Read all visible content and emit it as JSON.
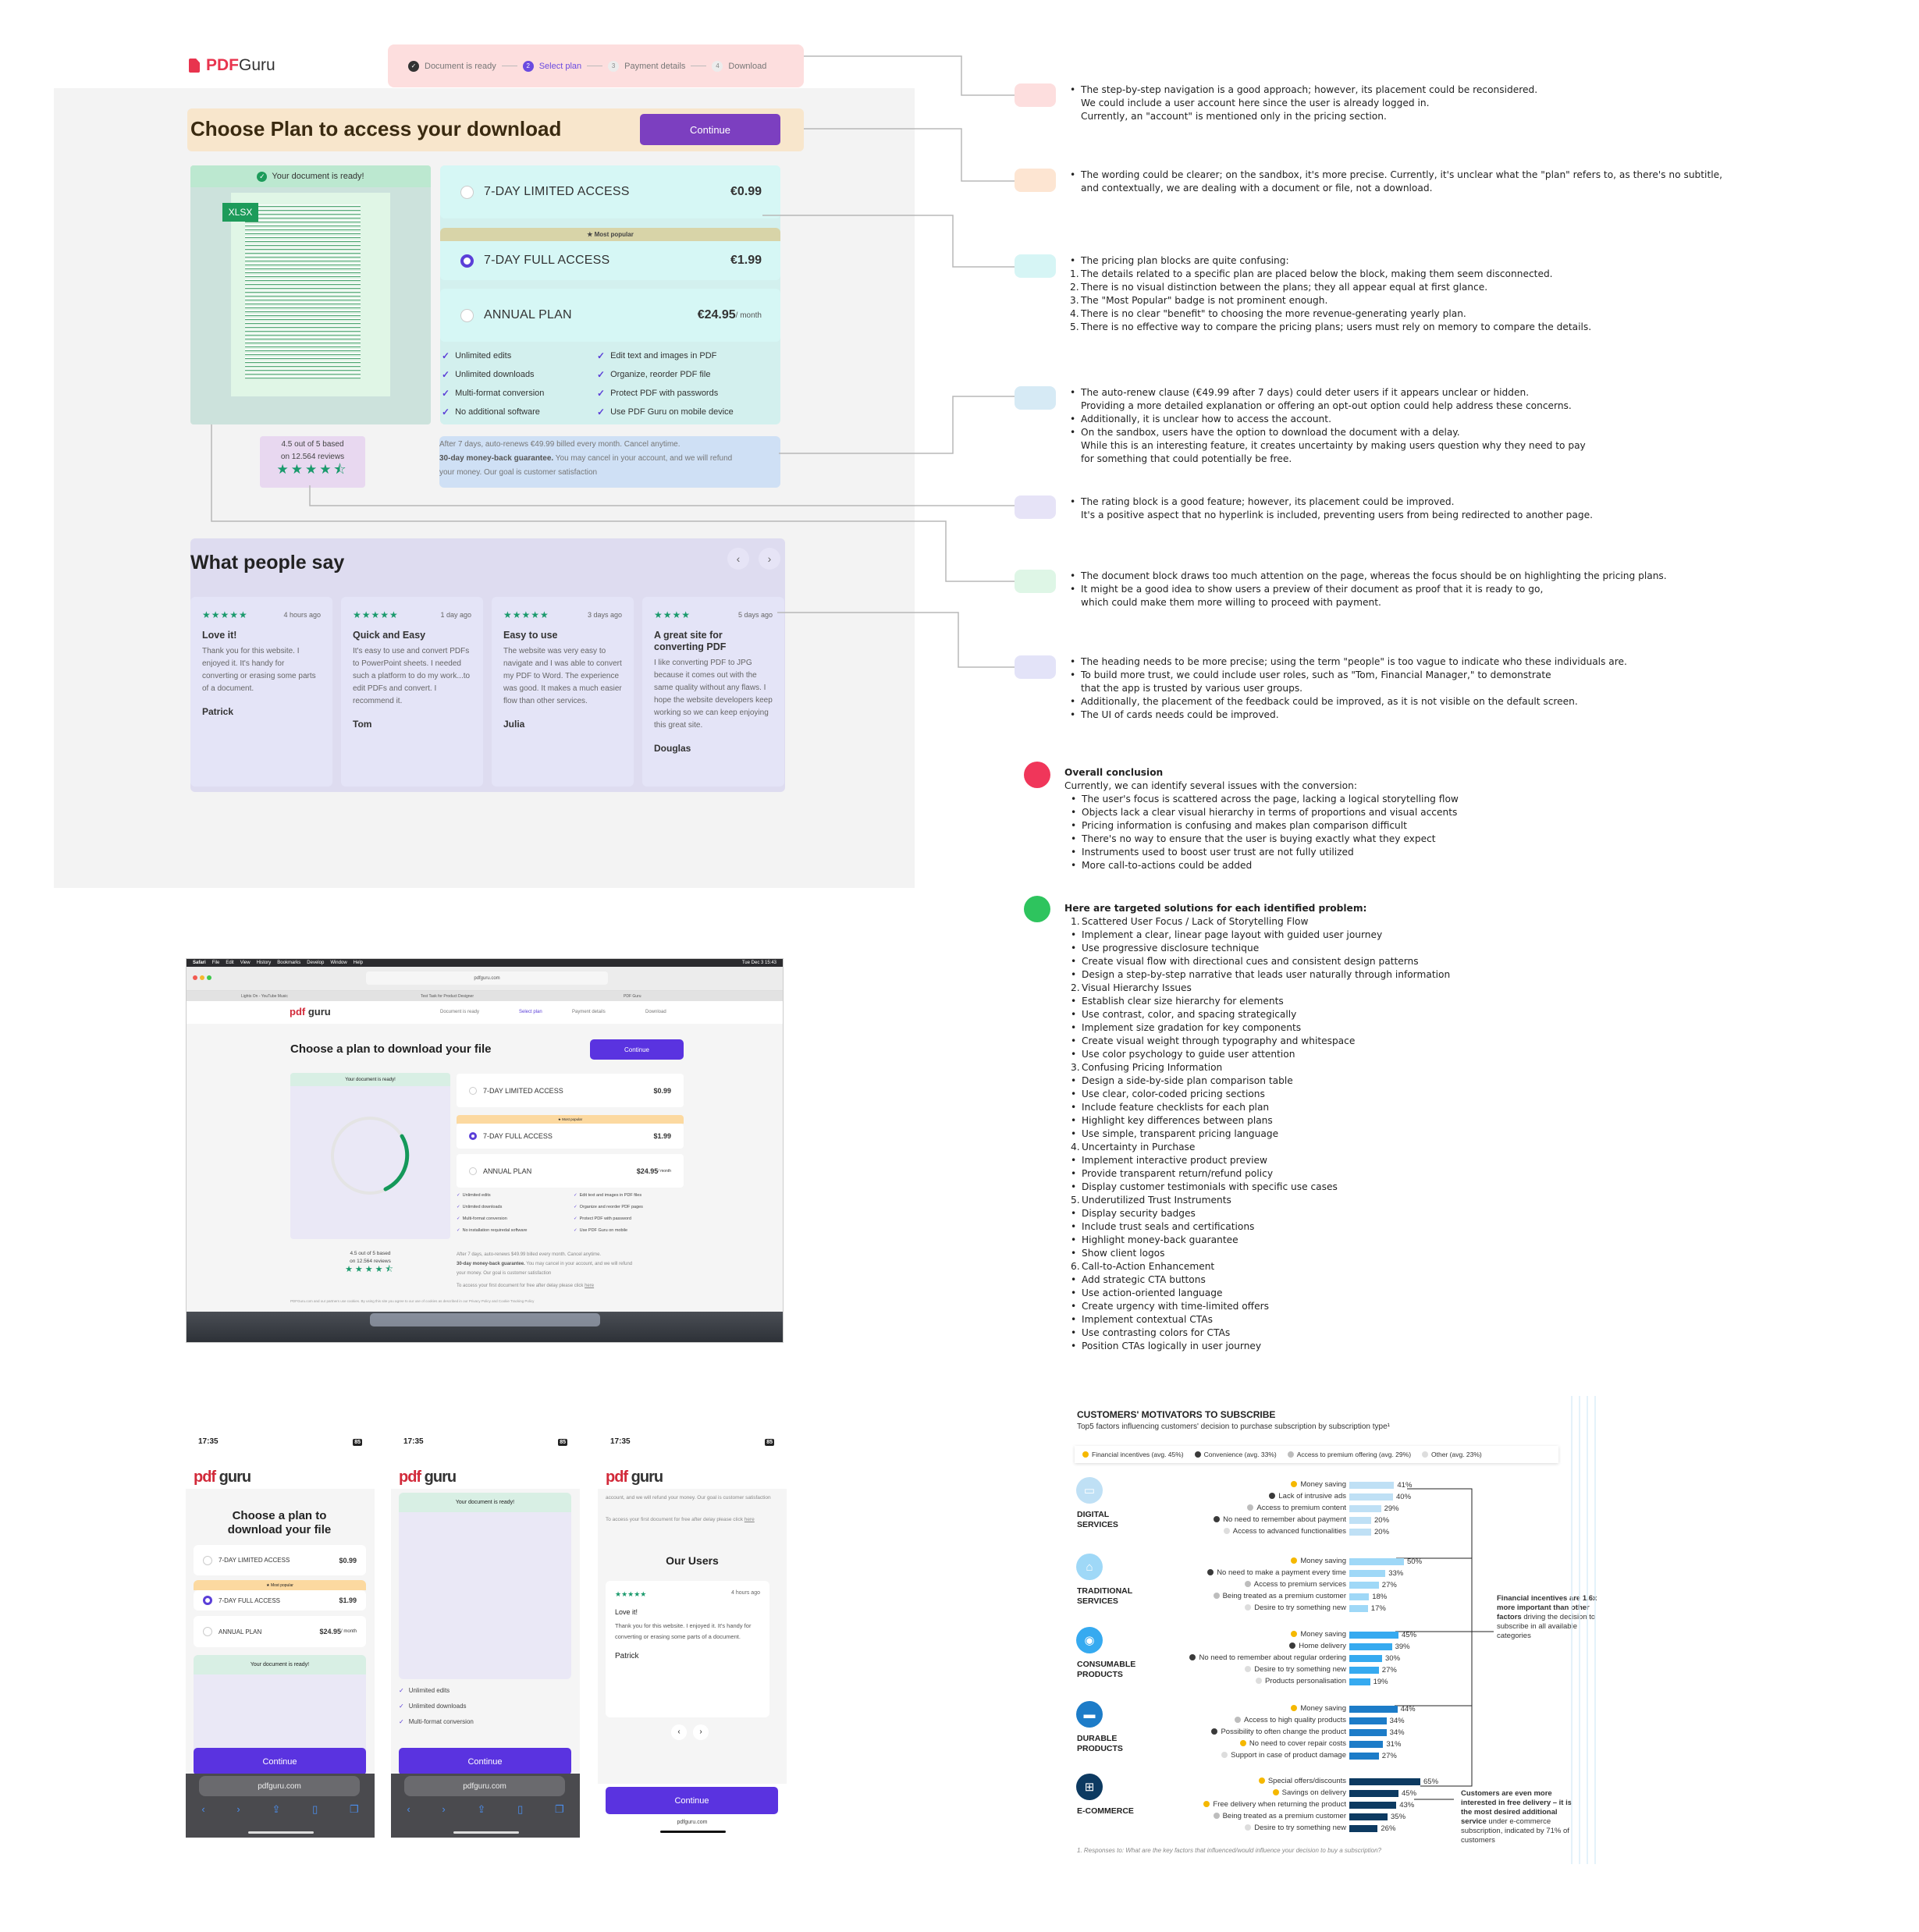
{
  "mockup": {
    "logo": {
      "brand": "PDF",
      "name": " Guru"
    },
    "stepper": [
      {
        "num": "✓",
        "label": "Document is ready",
        "state": "done"
      },
      {
        "num": "2",
        "label": "Select plan",
        "state": "active"
      },
      {
        "num": "3",
        "label": "Payment details",
        "state": "todo"
      },
      {
        "num": "4",
        "label": "Download",
        "state": "todo"
      }
    ],
    "heading": "Choose Plan to access your download",
    "continue_label": "Continue",
    "doc_ready": "Your document is ready!",
    "file_badge": "XLSX",
    "plans": [
      {
        "name": "7-DAY LIMITED ACCESS",
        "price": "€0.99",
        "unit": "",
        "selected": false
      },
      {
        "name": "7-DAY FULL ACCESS",
        "price": "€1.99",
        "unit": "",
        "selected": true
      },
      {
        "name": "ANNUAL PLAN",
        "price": "€24.95",
        "unit": "/ month",
        "selected": false
      }
    ],
    "most_popular": "★ Most popular",
    "features": [
      "Unlimited edits",
      "Edit text and images in PDF",
      "Unlimited downloads",
      "Organize, reorder PDF file",
      "Multi-format conversion",
      "Protect PDF with passwords",
      "No additional software",
      "Use PDF Guru on mobile device"
    ],
    "rating": {
      "line1": "4.5 out of 5 based",
      "line2": "on 12.564 reviews",
      "value": 4.5
    },
    "autorenew": {
      "line1": "After 7 days, auto-renews €49.99 billed every month. Cancel anytime.",
      "bold": "30-day money-back guarantee.",
      "line2": " You may cancel in your account, and we will refund",
      "line3": "your money. Our goal is customer satisfaction"
    },
    "reviews_title": "What people say",
    "reviews": [
      {
        "rating": 5,
        "time": "4 hours ago",
        "title": "Love it!",
        "body": "Thank you for this website. I enjoyed it. It's handy for converting or erasing some parts of a document.",
        "author": "Patrick"
      },
      {
        "rating": 5,
        "time": "1 day ago",
        "title": "Quick and Easy",
        "body": "It's easy to use and convert PDFs to PowerPoint sheets. I needed such a platform to do my work...to edit PDFs and convert. I recommend it.",
        "author": "Tom"
      },
      {
        "rating": 5,
        "time": "3 days ago",
        "title": "Easy to use",
        "body": "The website was very easy to navigate and I was able to convert my PDF to Word. The experience was good. It makes a much easier flow than other services.",
        "author": "Julia"
      },
      {
        "rating": 4,
        "time": "5 days ago",
        "title": "A great site for converting PDF",
        "body": "I like converting PDF to JPG because it comes out with the same quality without any flaws. I hope the website developers keep working so we can keep enjoying this great site.",
        "author": "Douglas"
      }
    ]
  },
  "notes": [
    {
      "color": "#fddede",
      "lines": [
        {
          "m": "•",
          "t": "The step-by-step navigation is a good approach; however, its placement could be reconsidered."
        },
        {
          "m": "",
          "t": "We could include a user account here since the user is already logged in."
        },
        {
          "m": "",
          "t": "Currently, an \"account\" is mentioned only in the pricing section."
        }
      ]
    },
    {
      "color": "#fde5d2",
      "lines": [
        {
          "m": "•",
          "t": "The wording could be clearer; on the sandbox, it's more precise. Currently, it's unclear what the \"plan\" refers to, as there's no subtitle,"
        },
        {
          "m": "",
          "t": "and contextually, we are dealing with a document or file, not a download."
        }
      ]
    },
    {
      "color": "#d6f5f5",
      "lines": [
        {
          "m": "•",
          "t": "The pricing plan blocks are quite confusing:"
        },
        {
          "m": "1.",
          "t": "The details related to a specific plan are placed below the block, making them seem disconnected."
        },
        {
          "m": "2.",
          "t": "There is no visual distinction between the plans; they all appear equal at first glance."
        },
        {
          "m": "3.",
          "t": "The \"Most Popular\" badge is not prominent enough."
        },
        {
          "m": "4.",
          "t": "There is no clear \"benefit\" to choosing the more revenue-generating yearly plan."
        },
        {
          "m": "5.",
          "t": "There is no effective way to compare the pricing plans; users must rely on memory to compare the details."
        }
      ]
    },
    {
      "color": "#d6eaf5",
      "lines": [
        {
          "m": "•",
          "t": "The auto-renew clause (€49.99 after 7 days) could deter users if it appears unclear or hidden."
        },
        {
          "m": "",
          "t": "Providing a more detailed explanation or offering an opt-out option could help address these concerns."
        },
        {
          "m": "•",
          "t": "Additionally, it is unclear how to access the account."
        },
        {
          "m": "•",
          "t": "On the sandbox, users have the option to download the document with a delay."
        },
        {
          "m": "",
          "t": "While this is an interesting feature, it creates uncertainty by making users question why they need to pay"
        },
        {
          "m": "",
          "t": "for something that could potentially be free."
        }
      ]
    },
    {
      "color": "#e6e3f7",
      "lines": [
        {
          "m": "•",
          "t": "The rating block is a good feature; however, its placement could be improved."
        },
        {
          "m": "",
          "t": "It's a positive aspect that no hyperlink is included, preventing users from being redirected to another page."
        }
      ]
    },
    {
      "color": "#def6e6",
      "lines": [
        {
          "m": "•",
          "t": "The document block draws too much attention on the page, whereas the focus should be on highlighting the pricing plans."
        },
        {
          "m": "•",
          "t": "It might be a good idea to show users a preview of their document as proof that it is ready to go,"
        },
        {
          "m": "",
          "t": "which could make them more willing to proceed with payment."
        }
      ]
    },
    {
      "color": "#e3e3f8",
      "lines": [
        {
          "m": "•",
          "t": "The heading needs to be more precise; using the term \"people\" is too vague to indicate who these individuals are."
        },
        {
          "m": "•",
          "t": "To build more trust, we could include user roles, such as \"Tom, Financial Manager,\" to demonstrate"
        },
        {
          "m": "",
          "t": " that the app is trusted by various user groups."
        },
        {
          "m": "•",
          "t": "Additionally, the placement of the feedback could be improved, as it is not visible on the default screen."
        },
        {
          "m": "•",
          "t": "The UI of cards needs could be improved."
        }
      ]
    }
  ],
  "conclusion": {
    "color": "#f0365a",
    "title": "Overall conclusion",
    "intro": "Currently, we can identify several issues with the conversion:",
    "lines": [
      {
        "m": "•",
        "t": "The user's focus is scattered across the page, lacking a logical storytelling flow"
      },
      {
        "m": "•",
        "t": "Objects lack a clear visual hierarchy in terms of proportions and visual accents"
      },
      {
        "m": "•",
        "t": "Pricing information is confusing and makes plan comparison difficult"
      },
      {
        "m": "•",
        "t": "There's no way to ensure that the user is buying exactly what they expect"
      },
      {
        "m": "•",
        "t": "Instruments used to boost user trust are not fully utilized"
      },
      {
        "m": "•",
        "t": "More call-to-actions could be added"
      }
    ]
  },
  "solutions": {
    "color": "#2ec45e",
    "title": "Here are targeted solutions for each identified problem:",
    "lines": [
      {
        "m": "1.",
        "t": "Scattered User Focus / Lack of Storytelling Flow"
      },
      {
        "m": "•",
        "t": "Implement a clear, linear page layout with guided user journey"
      },
      {
        "m": "•",
        "t": "Use progressive disclosure technique"
      },
      {
        "m": "•",
        "t": "Create visual flow with directional cues and consistent design patterns"
      },
      {
        "m": "•",
        "t": "Design a step-by-step narrative that leads user naturally through information"
      },
      {
        "m": "2.",
        "t": "Visual Hierarchy Issues"
      },
      {
        "m": "•",
        "t": "Establish clear size hierarchy for elements"
      },
      {
        "m": "•",
        "t": "Use contrast, color, and spacing strategically"
      },
      {
        "m": "•",
        "t": "Implement size gradation for key components"
      },
      {
        "m": "•",
        "t": "Create visual weight through typography and whitespace"
      },
      {
        "m": "•",
        "t": "Use color psychology to guide user attention"
      },
      {
        "m": "3.",
        "t": "Confusing Pricing Information"
      },
      {
        "m": "•",
        "t": "Design a side-by-side plan comparison table"
      },
      {
        "m": "•",
        "t": "Use clear, color-coded pricing sections"
      },
      {
        "m": "•",
        "t": "Include feature checklists for each plan"
      },
      {
        "m": "•",
        "t": "Highlight key differences between plans"
      },
      {
        "m": "•",
        "t": "Use simple, transparent pricing language"
      },
      {
        "m": "4.",
        "t": "Uncertainty in Purchase"
      },
      {
        "m": "•",
        "t": "Implement interactive product preview"
      },
      {
        "m": "•",
        "t": "Provide transparent return/refund policy"
      },
      {
        "m": "•",
        "t": "Display customer testimonials with specific use cases"
      },
      {
        "m": "5.",
        "t": "Underutilized Trust Instruments"
      },
      {
        "m": "•",
        "t": "Display security badges"
      },
      {
        "m": "•",
        "t": "Include trust seals and certifications"
      },
      {
        "m": "•",
        "t": "Highlight money-back guarantee"
      },
      {
        "m": "•",
        "t": "Show client logos"
      },
      {
        "m": "6.",
        "t": "Call-to-Action Enhancement"
      },
      {
        "m": "•",
        "t": "Add strategic CTA buttons"
      },
      {
        "m": "•",
        "t": "Use action-oriented language"
      },
      {
        "m": "•",
        "t": "Create urgency with time-limited offers"
      },
      {
        "m": "•",
        "t": "Implement contextual CTAs"
      },
      {
        "m": "•",
        "t": "Use contrasting colors for CTAs"
      },
      {
        "m": "•",
        "t": "Position CTAs logically in user journey"
      }
    ]
  },
  "desktop": {
    "menubar": [
      "Safari",
      "File",
      "Edit",
      "View",
      "History",
      "Bookmarks",
      "Develop",
      "Window",
      "Help"
    ],
    "clock": "Tue Dec 3  15:43",
    "url": "pdfguru.com",
    "tabs": [
      "Lights On - YouTube Music",
      "Test Task for Product Designer",
      "PDF Guru"
    ],
    "logo": {
      "brand": "pdf",
      "name": " guru"
    },
    "stepper": [
      "Document is ready",
      "Select plan",
      "Payment details",
      "Download"
    ],
    "heading": "Choose a plan to download your file",
    "continue_label": "Continue",
    "doc_ready": "Your document is ready!",
    "plans": [
      {
        "name": "7-DAY LIMITED ACCESS",
        "price": "$0.99",
        "unit": ""
      },
      {
        "name": "7-DAY FULL ACCESS",
        "price": "$1.99",
        "unit": ""
      },
      {
        "name": "ANNUAL PLAN",
        "price": "$24.95",
        "unit": "/ month"
      }
    ],
    "most_popular": "★ Most popular",
    "features": [
      "Unlimited edits",
      "Edit text and images in PDF files",
      "Unlimited downloads",
      "Organize and reorder PDF pages",
      "Multi-format conversion",
      "Protect PDF with password",
      "No installation requiredal software",
      "Use PDF Guru on mobile"
    ],
    "rating": {
      "line1": "4.5 out of 5 based",
      "line2": "on 12.564 reviews"
    },
    "autorenew": {
      "line1": "After 7 days, auto-renews $49.99 billed every month. Cancel anytime.",
      "bold": "30-day money-back guarantee.",
      "line2": " You may cancel in your account, and we will refund",
      "line3": "your money. Our goal is customer satisfaction",
      "free_text": "To access your first document for free after delay please click ",
      "free_link": "here"
    },
    "cookie": "PDFGuru.com and our partners use cookies. By using this site you agree to our use of cookies as described in our Privacy Policy and Cookie Tracking Policy"
  },
  "mobile": {
    "time": "17:35",
    "battery": "85",
    "logo": {
      "brand": "pdf",
      "name": " guru"
    },
    "heading": "Choose a plan to download your file",
    "plans": [
      {
        "name": "7-DAY LIMITED ACCESS",
        "price": "$0.99",
        "unit": ""
      },
      {
        "name": "7-DAY FULL ACCESS",
        "price": "$1.99",
        "unit": ""
      },
      {
        "name": "ANNUAL PLAN",
        "price": "$24.95",
        "unit": "/ month"
      }
    ],
    "most_popular": "★ Most popular",
    "doc_ready": "Your document is ready!",
    "continue_label": "Continue",
    "url": "pdfguru.com",
    "features": [
      "Unlimited edits",
      "Unlimited downloads",
      "Multi-format conversion"
    ],
    "refund_text": "account, and we will refund your money. Our goal is customer satisfaction",
    "free_text": "To access your first document for free after delay please click ",
    "free_link": "here",
    "users_title": "Our Users",
    "review": {
      "rating": 5,
      "time": "4 hours ago",
      "title": "Love it!",
      "body": "Thank you for this website. I enjoyed it. It's handy for converting or erasing some parts of a document.",
      "author": "Patrick"
    }
  },
  "chart_data": {
    "type": "bar",
    "title": "CUSTOMERS' MOTIVATORS TO SUBSCRIBE",
    "subtitle": "Top5 factors influencing customers' decision to purchase subscription by subscription type¹",
    "legend": [
      {
        "key": "financial",
        "label": "Financial incentives (avg. 45%)",
        "color": "#f5b800"
      },
      {
        "key": "convenience",
        "label": "Convenience (avg. 33%)",
        "color": "#3a3a3a"
      },
      {
        "key": "premium",
        "label": "Access to premium offering (avg. 29%)",
        "color": "#bdbdbd"
      },
      {
        "key": "other",
        "label": "Other (avg. 23%)",
        "color": "#dddddd"
      }
    ],
    "unit": "%",
    "groups": [
      {
        "name": "DIGITAL SERVICES",
        "icon": "laptop-icon",
        "color": "#bfe0f5",
        "items": [
          {
            "label": "Money saving",
            "value": 41,
            "factor": "financial"
          },
          {
            "label": "Lack of intrusive ads",
            "value": 40,
            "factor": "convenience"
          },
          {
            "label": "Access to premium content",
            "value": 29,
            "factor": "premium"
          },
          {
            "label": "No need to remember about payment",
            "value": 20,
            "factor": "convenience"
          },
          {
            "label": "Access to advanced functionalities",
            "value": 20,
            "factor": "other"
          }
        ]
      },
      {
        "name": "TRADITIONAL SERVICES",
        "icon": "house-icon",
        "color": "#9fd8f7",
        "items": [
          {
            "label": "Money saving",
            "value": 50,
            "factor": "financial"
          },
          {
            "label": "No need to make a payment every time",
            "value": 33,
            "factor": "convenience"
          },
          {
            "label": "Access to premium services",
            "value": 27,
            "factor": "premium"
          },
          {
            "label": "Being treated as a premium customer",
            "value": 18,
            "factor": "premium"
          },
          {
            "label": "Desire to try something new",
            "value": 17,
            "factor": "other"
          }
        ]
      },
      {
        "name": "CONSUMABLE PRODUCTS",
        "icon": "bowl-icon",
        "color": "#36aaf0",
        "items": [
          {
            "label": "Money saving",
            "value": 45,
            "factor": "financial"
          },
          {
            "label": "Home delivery",
            "value": 39,
            "factor": "convenience"
          },
          {
            "label": "No need to remember about regular ordering",
            "value": 30,
            "factor": "convenience"
          },
          {
            "label": "Desire to try something new",
            "value": 27,
            "factor": "other"
          },
          {
            "label": "Products personalisation",
            "value": 19,
            "factor": "other"
          }
        ]
      },
      {
        "name": "DURABLE PRODUCTS",
        "icon": "sofa-icon",
        "color": "#1d7cc8",
        "items": [
          {
            "label": "Money saving",
            "value": 44,
            "factor": "financial"
          },
          {
            "label": "Access to high quality products",
            "value": 34,
            "factor": "premium"
          },
          {
            "label": "Possibility to often change the product",
            "value": 34,
            "factor": "convenience"
          },
          {
            "label": "No need to cover repair costs",
            "value": 31,
            "factor": "financial"
          },
          {
            "label": "Support in case of product damage",
            "value": 27,
            "factor": "other"
          }
        ]
      },
      {
        "name": "E-COMMERCE",
        "icon": "basket-icon",
        "color": "#0d3a61",
        "items": [
          {
            "label": "Special offers/discounts",
            "value": 65,
            "factor": "financial"
          },
          {
            "label": "Savings on delivery",
            "value": 45,
            "factor": "financial"
          },
          {
            "label": "Free delivery when returning the product",
            "value": 43,
            "factor": "financial"
          },
          {
            "label": "Being treated as a premium customer",
            "value": 35,
            "factor": "premium"
          },
          {
            "label": "Desire to try something new",
            "value": 26,
            "factor": "other"
          }
        ]
      }
    ],
    "annotations": [
      {
        "bold": "Financial incentives are 1.6x more important than other factors",
        "text": " driving the decision to subscribe in all available categories"
      },
      {
        "bold": "Customers are even more interested in free delivery – it is the most desired additional service",
        "text": " under e-commerce subscription, indicated by 71% of customers"
      }
    ],
    "footnote": "1.   Responses to: What are the key factors that influenced/would influence your decision to buy a subscription?"
  }
}
